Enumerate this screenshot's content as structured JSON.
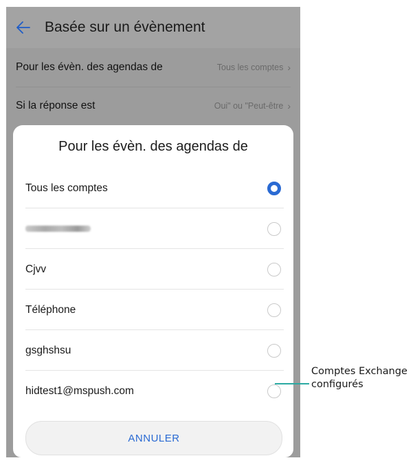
{
  "appbar": {
    "title": "Basée sur un évènement"
  },
  "settings": [
    {
      "label": "Pour les évèn. des agendas de",
      "value": "Tous les comptes"
    },
    {
      "label": "Si la réponse est",
      "value": "Oui\" ou \"Peut-être"
    }
  ],
  "dialog": {
    "title": "Pour les évèn. des agendas de",
    "options": [
      {
        "label": "Tous les comptes",
        "selected": true
      },
      {
        "label": "",
        "selected": false,
        "redacted": true
      },
      {
        "label": "Cjvv",
        "selected": false
      },
      {
        "label": "Téléphone",
        "selected": false
      },
      {
        "label": "gsghshsu",
        "selected": false
      },
      {
        "label": "hidtest1@mspush.com",
        "selected": false
      }
    ],
    "cancel_label": "ANNULER"
  },
  "callout": {
    "line1": "Comptes Exchange",
    "line2": "configurés"
  },
  "colors": {
    "accent": "#2a6ad3",
    "callout": "#2aa9a2"
  }
}
